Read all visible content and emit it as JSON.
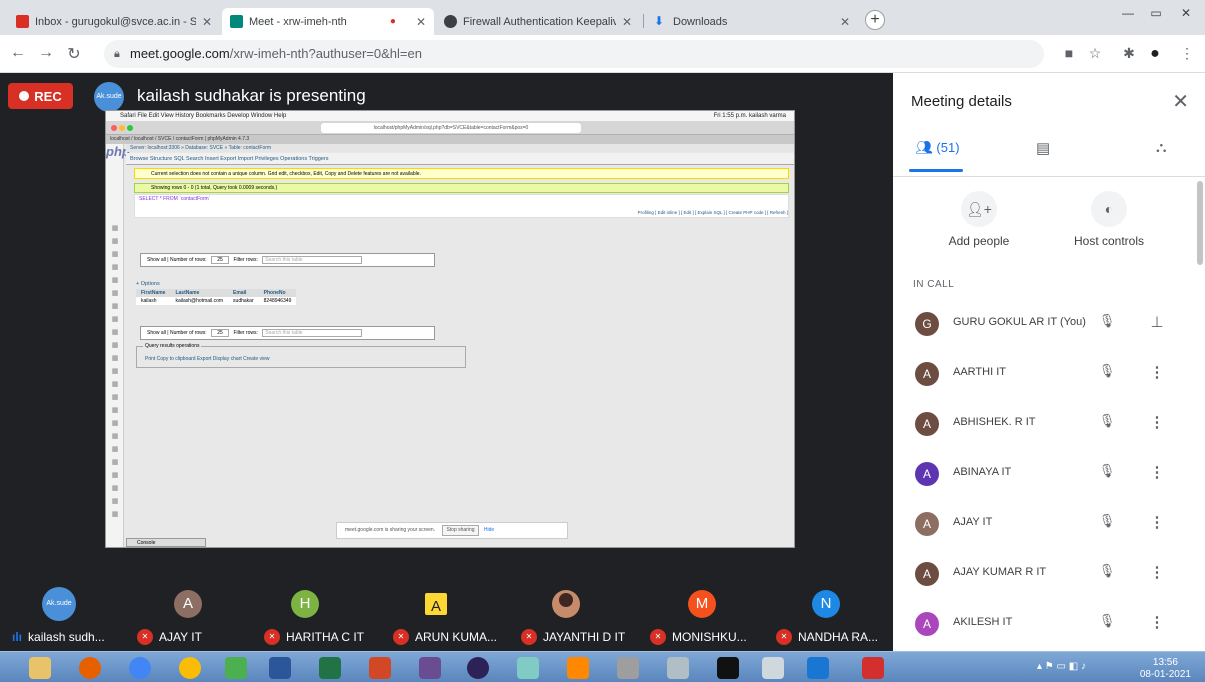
{
  "browser": {
    "tabs": [
      {
        "title": "Inbox - gurugokul@svce.ac.in - S",
        "fav": "#d93025"
      },
      {
        "title": "Meet - xrw-imeh-nth",
        "fav": "#00897b",
        "active": true
      },
      {
        "title": "Firewall Authentication Keepalive",
        "fav": "#3c4043"
      },
      {
        "title": "Downloads",
        "fav": "#1a73e8"
      }
    ],
    "url_host": "meet.google.com",
    "url_rest": "/xrw-imeh-nth?authuser=0&hl=en"
  },
  "stage": {
    "rec_label": "REC",
    "presenter_avatar_text": "Ak.sude",
    "presenting_text": "kailash sudhakar is presenting"
  },
  "shared": {
    "mac_menu": "Safari   File   Edit   View   History   Bookmarks   Develop   Window   Help",
    "mac_status": "Fri 1:55 p.m.   kailash varma",
    "mac_url": "localhost/phpMyAdmin/sql.php?db=SVCE&table=contactForm&pos=0",
    "mac_tabs": "localhost / localhost / SVCE / contactForm | phpMyAdmin 4.7.3",
    "pma_logo": "php",
    "crumb": "Server: localhost:3306 » Database: SVCE » Table: contactForm",
    "tabs": "Browse    Structure    SQL    Search    Insert    Export    Import    Privileges    Operations    Triggers",
    "notice": "Current selection does not contain a unique column. Grid edit, checkbox, Edit, Copy and Delete features are not available.",
    "success": "Showing rows 0 - 0 (1 total, Query took 0.0009 seconds.)",
    "sql": "SELECT * FROM `contactForm`",
    "profiling": "Profiling [ Edit inline ] [ Edit ] [ Explain SQL ] [ Create PHP code ] [ Refresh ]",
    "show_all": "Show all",
    "num_rows_label": "Number of rows:",
    "num_rows": "25",
    "filter_label": "Filter rows:",
    "filter_placeholder": "Search this table",
    "options": "+ Options",
    "table_head": [
      "FirstName",
      "LastName",
      "Email",
      "PhoneNo"
    ],
    "table_row": [
      "kailash",
      "kailash@hotmail.com",
      "sudhakar",
      "8248946349"
    ],
    "qro_legend": "Query results operations",
    "qro_ops": "Print   Copy to clipboard   Export   Display chart   Create view",
    "console": "Console",
    "share_msg": "meet.google.com is sharing your screen.",
    "share_stop": "Stop sharing",
    "share_hide": "Hide"
  },
  "strip": [
    {
      "name": "kailash sudh...",
      "avatar": "Ak.sude",
      "color": "#4a90d9",
      "speaking": true
    },
    {
      "name": "AJAY IT",
      "avatar": "A",
      "color": "#8d6e63"
    },
    {
      "name": "HARITHA C IT",
      "avatar": "H",
      "color": "#7cb342"
    },
    {
      "name": "ARUN KUMA...",
      "avatar": "A",
      "color": "#fdd835"
    },
    {
      "name": "JAYANTHI D IT",
      "avatar": "",
      "color": "#c58b6b"
    },
    {
      "name": "MONISHKU...",
      "avatar": "M",
      "color": "#f4511e"
    },
    {
      "name": "NANDHA RA...",
      "avatar": "N",
      "color": "#1e88e5"
    }
  ],
  "panel": {
    "title": "Meeting details",
    "people_count": "(51)",
    "add_people": "Add people",
    "host_controls": "Host controls",
    "in_call": "IN CALL",
    "participants": [
      {
        "initial": "G",
        "name": "GURU GOKUL AR IT (You)",
        "color": "#6d4c41",
        "self": true
      },
      {
        "initial": "A",
        "name": "AARTHI IT",
        "color": "#6d4c41"
      },
      {
        "initial": "A",
        "name": "ABHISHEK. R IT",
        "color": "#6d4c41"
      },
      {
        "initial": "A",
        "name": "ABINAYA IT",
        "color": "#5e35b1"
      },
      {
        "initial": "A",
        "name": "AJAY IT",
        "color": "#8d6e63"
      },
      {
        "initial": "A",
        "name": "AJAY KUMAR R IT",
        "color": "#6d4c41"
      },
      {
        "initial": "A",
        "name": "AKILESH IT",
        "color": "#ab47bc"
      }
    ]
  },
  "taskbar": {
    "time": "13:56",
    "date": "08-01-2021"
  },
  "colors": {
    "accent": "#1a73e8",
    "rec": "#d93025",
    "meet_bg": "#202124"
  }
}
